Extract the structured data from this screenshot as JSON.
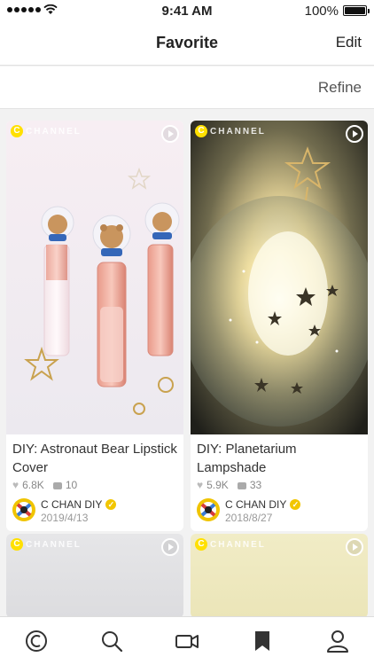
{
  "status": {
    "time": "9:41 AM",
    "battery": "100%"
  },
  "nav": {
    "title": "Favorite",
    "edit": "Edit"
  },
  "refine": "Refine",
  "brand": {
    "logo_letter": "C",
    "logo_text": "CHANNEL",
    "accent": "#ffe000"
  },
  "cards": [
    {
      "title": "DIY: Astronaut Bear Lipstick Cover",
      "likes": "6.8K",
      "comments": "10",
      "author": "C CHAN DIY",
      "date": "2019/4/13"
    },
    {
      "title": "DIY: Planetarium Lampshade",
      "likes": "5.9K",
      "comments": "33",
      "author": "C CHAN DIY",
      "date": "2018/8/27"
    }
  ],
  "icons": {
    "tabs": [
      "cchannel-icon",
      "search-icon",
      "video-camera-icon",
      "bookmark-icon",
      "profile-icon"
    ]
  }
}
